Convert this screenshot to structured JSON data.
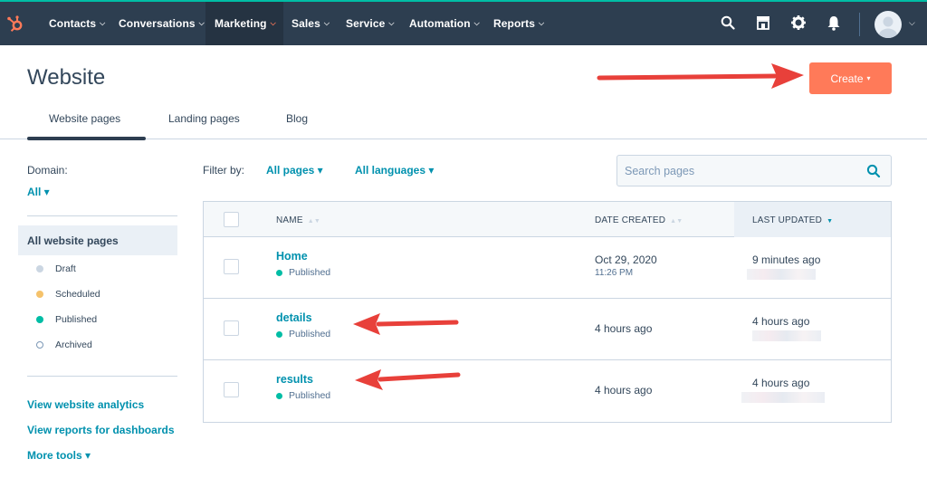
{
  "nav": {
    "items": [
      {
        "label": "Contacts",
        "active": false
      },
      {
        "label": "Conversations",
        "active": false
      },
      {
        "label": "Marketing",
        "active": true
      },
      {
        "label": "Sales",
        "active": false
      },
      {
        "label": "Service",
        "active": false
      },
      {
        "label": "Automation",
        "active": false
      },
      {
        "label": "Reports",
        "active": false
      }
    ],
    "chevron": "⌵",
    "icons": [
      "search-icon",
      "marketplace-icon",
      "gear-icon",
      "bell-icon"
    ]
  },
  "header": {
    "title": "Website",
    "create_label": "Create",
    "create_caret": "▾"
  },
  "tabs": [
    {
      "label": "Website pages",
      "active": true
    },
    {
      "label": "Landing pages",
      "active": false
    },
    {
      "label": "Blog",
      "active": false
    }
  ],
  "sidebar": {
    "domain_label": "Domain:",
    "domain_value": "All ▾",
    "active_filter": "All website pages",
    "statuses": [
      {
        "label": "Draft",
        "color": "#cbd6e2"
      },
      {
        "label": "Scheduled",
        "color": "#f5c26b"
      },
      {
        "label": "Published",
        "color": "#00bda5"
      },
      {
        "label": "Archived",
        "color": "hollow"
      }
    ],
    "links": [
      "View website analytics",
      "View reports for dashboards",
      "More tools ▾"
    ]
  },
  "filters": {
    "label": "Filter by:",
    "pages": "All pages ▾",
    "languages": "All languages ▾"
  },
  "search": {
    "placeholder": "Search pages"
  },
  "table": {
    "columns": {
      "name": "NAME",
      "date_created": "DATE CREATED",
      "last_updated": "LAST UPDATED"
    },
    "rows": [
      {
        "name": "Home",
        "status": "Published",
        "date_created": "Oct 29, 2020",
        "time_created": "11:26 PM",
        "last_updated": "9 minutes ago"
      },
      {
        "name": "details",
        "status": "Published",
        "date_created": "4 hours ago",
        "time_created": "",
        "last_updated": "4 hours ago"
      },
      {
        "name": "results",
        "status": "Published",
        "date_created": "4 hours ago",
        "time_created": "",
        "last_updated": "4 hours ago"
      }
    ]
  },
  "colors": {
    "nav_bg": "#2d3e50",
    "accent": "#ff7a59",
    "link": "#0091ae",
    "published": "#00bda5",
    "annotation_arrow": "#e8403a"
  }
}
